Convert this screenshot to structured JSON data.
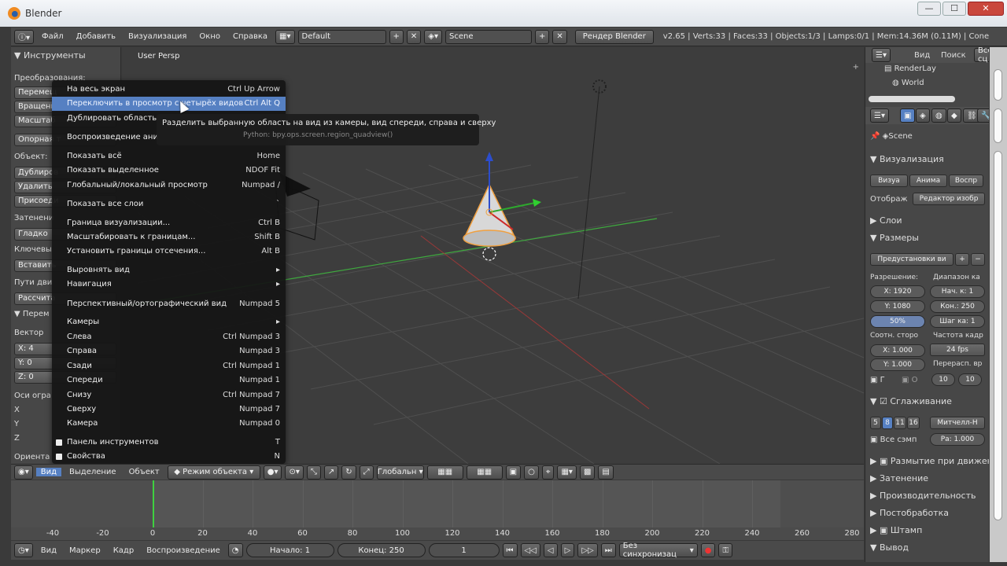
{
  "window": {
    "title": "Blender"
  },
  "topbar": {
    "menus": [
      "Файл",
      "Добавить",
      "Визуализация",
      "Окно",
      "Справка"
    ],
    "layout": "Default",
    "scene": "Scene",
    "engine": "Рендер Blender",
    "status": "v2.65 | Verts:33 | Faces:33 | Objects:1/3 | Lamps:0/1 | Mem:14.36M (0.11M) | Cone"
  },
  "left_panel": {
    "header": "Инструменты",
    "items": [
      {
        "kind": "label",
        "text": "Преобразования:"
      },
      {
        "kind": "btn",
        "text": "Перемещ"
      },
      {
        "kind": "btn",
        "text": "Вращени"
      },
      {
        "kind": "btn",
        "text": "Масштаб"
      },
      {
        "kind": "btn",
        "text": "Опорная т"
      },
      {
        "kind": "label",
        "text": "Объект:"
      },
      {
        "kind": "btn",
        "text": "Дублиров"
      },
      {
        "kind": "btn",
        "text": "Удалить"
      },
      {
        "kind": "btn",
        "text": "Присоеди"
      },
      {
        "kind": "label",
        "text": "Затенени"
      },
      {
        "kind": "btn",
        "text": "Гладко"
      },
      {
        "kind": "label",
        "text": "Ключевы"
      },
      {
        "kind": "btn",
        "text": "Вставить"
      },
      {
        "kind": "label",
        "text": "Пути дви"
      },
      {
        "kind": "btn",
        "text": "Рассчита"
      },
      {
        "kind": "label",
        "text": "▼ Перем"
      },
      {
        "kind": "label",
        "text": "Вектор"
      },
      {
        "kind": "btn",
        "text": "X: 4"
      },
      {
        "kind": "btn",
        "text": "Y: 0"
      },
      {
        "kind": "btn",
        "text": "Z: 0"
      },
      {
        "kind": "label",
        "text": "Оси огра"
      },
      {
        "kind": "label",
        "text": "X"
      },
      {
        "kind": "label",
        "text": "Y"
      },
      {
        "kind": "label",
        "text": "Z"
      },
      {
        "kind": "label",
        "text": "Ориента"
      }
    ]
  },
  "viewport": {
    "label": "User Persp"
  },
  "context_menu": {
    "items": [
      {
        "label": "На весь экран",
        "shortcut": "Ctrl Up Arrow"
      },
      {
        "label": "Переключить в просмотр с четырёх видов",
        "shortcut": "Ctrl Alt Q",
        "highlight": true
      },
      {
        "label": "Дублировать область в",
        "shortcut": ""
      },
      {
        "label": "Воспроизведение аним",
        "shortcut": ""
      },
      {
        "label": "Показать всё",
        "shortcut": "Home"
      },
      {
        "label": "Показать выделенное",
        "shortcut": "NDOF Fit"
      },
      {
        "label": "Глобальный/локальный просмотр",
        "shortcut": "Numpad /"
      },
      {
        "label": "Показать все слои",
        "shortcut": "`"
      },
      {
        "label": "Граница визуализации...",
        "shortcut": "Ctrl B"
      },
      {
        "label": "Масштабировать к границам...",
        "shortcut": "Shift B"
      },
      {
        "label": "Установить границы отсечения...",
        "shortcut": "Alt B"
      },
      {
        "label": "Выровнять вид",
        "shortcut": "▸"
      },
      {
        "label": "Навигация",
        "shortcut": "▸"
      },
      {
        "label": "Перспективный/ортографический вид",
        "shortcut": "Numpad 5"
      },
      {
        "label": "Камеры",
        "shortcut": "▸"
      },
      {
        "label": "Слева",
        "shortcut": "Ctrl Numpad 3"
      },
      {
        "label": "Справа",
        "shortcut": "Numpad 3"
      },
      {
        "label": "Сзади",
        "shortcut": "Ctrl Numpad 1"
      },
      {
        "label": "Спереди",
        "shortcut": "Numpad 1"
      },
      {
        "label": "Снизу",
        "shortcut": "Ctrl Numpad 7"
      },
      {
        "label": "Сверху",
        "shortcut": "Numpad 7"
      },
      {
        "label": "Камера",
        "shortcut": "Numpad 0"
      },
      {
        "label": "Панель инструментов",
        "shortcut": "T",
        "check": true
      },
      {
        "label": "Свойства",
        "shortcut": "N",
        "check": true
      }
    ]
  },
  "tooltip": {
    "text": "Разделить выбранную область на вид из камеры, вид спереди, справа и сверху",
    "python": "Python: bpy.ops.screen.region_quadview()"
  },
  "bottombar": {
    "menus": [
      "Вид",
      "Выделение",
      "Объект"
    ],
    "mode": "Режим объекта",
    "orientation": "Глобальн"
  },
  "timeline": {
    "ticks": [
      "-40",
      "-20",
      "0",
      "20",
      "40",
      "60",
      "80",
      "100",
      "120",
      "140",
      "160",
      "180",
      "200",
      "220",
      "240",
      "260",
      "280"
    ]
  },
  "timeline_bar": {
    "menus": [
      "Вид",
      "Маркер",
      "Кадр",
      "Воспроизведение"
    ],
    "start": "Начало: 1",
    "end": "Конец: 250",
    "current": "1",
    "sync": "Без синхронизац"
  },
  "right_panel": {
    "outliner_menus": [
      "Вид",
      "Поиск"
    ],
    "outliner_filter": "Все сц",
    "outliner_items": [
      "RenderLay",
      "World"
    ],
    "scene_name": "Scene",
    "render_section": "Визуализация",
    "render_buttons": [
      "Визуа",
      "Анима",
      "Воспр"
    ],
    "display_label": "Отображ",
    "display_value": "Редактор изобр",
    "layers_section": "Слои",
    "dimensions_section": "Размеры",
    "presets": "Предустановки ви",
    "resolution_label": "Разрешение:",
    "frame_range_label": "Диапазон ка",
    "res_x": "X: 1920",
    "res_y": "Y: 1080",
    "res_pct": "50%",
    "frame_start": "Нач. к: 1",
    "frame_end": "Кон.: 250",
    "frame_step": "Шаг ка: 1",
    "aspect_label": "Соотн. сторо",
    "fps_label": "Частота кадр",
    "aspect_x": "X: 1.000",
    "aspect_y": "Y: 1.000",
    "fps": "24 fps",
    "remap_label": "Перерасп. вр",
    "border_label": "Г",
    "crop_label": "О",
    "remap_old": "10",
    "remap_new": "10",
    "aa_section": "Сглаживание",
    "aa_samples": [
      "5",
      "8",
      "11",
      "16"
    ],
    "aa_filter": "Митчелл-Н",
    "full_sample": "Все сэмп",
    "aa_size": "Ра: 1.000",
    "sections": [
      "Размытие при движен",
      "Затенение",
      "Производительность",
      "Постобработка",
      "Штамп",
      "Вывод"
    ]
  }
}
